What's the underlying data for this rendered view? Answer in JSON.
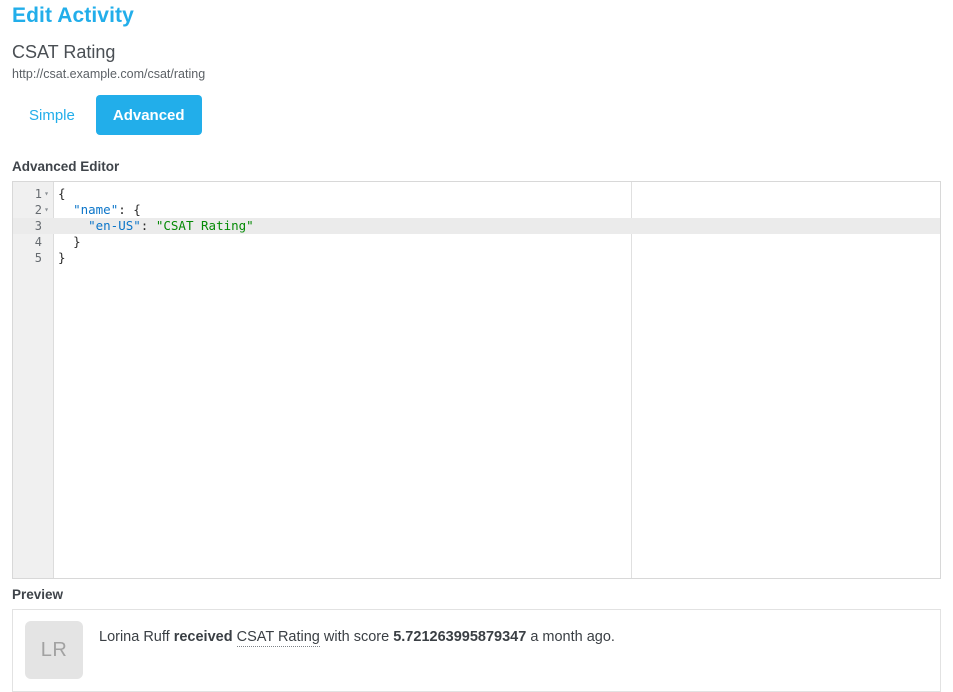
{
  "header": {
    "page_title": "Edit Activity",
    "activity_name": "CSAT Rating",
    "activity_url": "http://csat.example.com/csat/rating"
  },
  "tabs": [
    {
      "label": "Simple",
      "active": false
    },
    {
      "label": "Advanced",
      "active": true
    }
  ],
  "editor": {
    "label": "Advanced Editor",
    "active_line": 3,
    "lines": [
      {
        "number": "1",
        "fold": "▾",
        "indent": "",
        "content": "{",
        "type": "punct"
      },
      {
        "number": "2",
        "fold": "▾",
        "indent": "  ",
        "key": "\"name\"",
        "sep": ": ",
        "tail": "{"
      },
      {
        "number": "3",
        "fold": "",
        "indent": "    ",
        "key": "\"en-US\"",
        "sep": ": ",
        "value": "\"CSAT Rating\""
      },
      {
        "number": "4",
        "fold": "",
        "indent": "  ",
        "content": "}",
        "type": "punct"
      },
      {
        "number": "5",
        "fold": "",
        "indent": "",
        "content": "}",
        "type": "punct"
      }
    ]
  },
  "preview": {
    "label": "Preview",
    "avatar_initials": "LR",
    "user_name": "Lorina Ruff",
    "verb": "received",
    "object": "CSAT Rating",
    "with_score_label": "with score",
    "score": "5.721263995879347",
    "timestamp": "a month ago."
  },
  "colors": {
    "accent": "#22aeea",
    "key_token": "#0b75c9",
    "string_token": "#048a05",
    "gutter_bg": "#f0f0f0",
    "active_line_bg": "#ebebeb"
  }
}
